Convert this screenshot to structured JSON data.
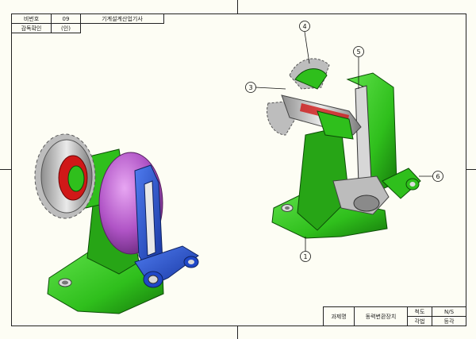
{
  "header": {
    "number_label": "비번호",
    "number_value": "09",
    "exam_title": "기계설계산업기사",
    "inspector_label": "감독확인",
    "inspector_value": "(인)"
  },
  "callouts": [
    "1",
    "3",
    "4",
    "5",
    "6"
  ],
  "title_block": {
    "project_label": "과제명",
    "project_name": "동력변환장치",
    "scale_label": "척도",
    "scale_value": "N/S",
    "projection_label": "각법",
    "projection_value": "등각"
  },
  "colors": {
    "frame": "#fdfdf4",
    "body_green": "#2fbf1c",
    "disk_magenta": "#b054c6",
    "link_blue": "#1f47c8",
    "gear_gray": "#bdbdbd",
    "hub_red": "#d01818"
  }
}
